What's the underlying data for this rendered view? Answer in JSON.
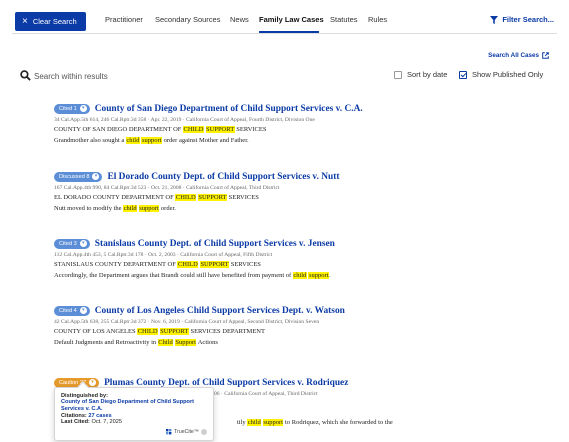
{
  "tabbar": {
    "clear_label": "Clear Search",
    "tabs": [
      "Practitioner",
      "Secondary Sources",
      "News",
      "Family Law Cases",
      "Statutes",
      "Rules"
    ],
    "filter_label": "Filter Search..."
  },
  "search_all_label": "Search All Cases",
  "search": {
    "placeholder": "Search within results",
    "sort_label": "Sort by date",
    "published_label": "Show Published Only"
  },
  "results": [
    {
      "badge": "Cited 1",
      "title": "County of San Diego Department of Child Support Services v. C.A.",
      "cite": "34 Cal.App.5th 614, 246 Cal.Rptr.3d 358  ·  Apr. 22, 2019  ·  California Court of Appeal, Fourth District, Division One",
      "dept_pre": "COUNTY OF SAN DIEGO DEPARTMENT OF ",
      "dept_hl1": "CHILD",
      "dept_mid": " ",
      "dept_hl2": "SUPPORT",
      "dept_post": " SERVICES",
      "snip_pre": "Grandmother also sought a ",
      "snip_hl1": "child",
      "snip_mid": " ",
      "snip_hl2": "support",
      "snip_post": " order against Mother and Father."
    },
    {
      "badge": "Discussed 8",
      "title": "El Dorado County Dept. of Child Support Services v. Nutt",
      "cite": "167 Cal.App.4th 990, 84 Cal.Rptr.3d 523  ·  Oct. 21, 2008  ·  California Court of Appeal, Third District",
      "dept_pre": "EL DORADO COUNTY DEPARTMENT OF ",
      "dept_hl1": "CHILD",
      "dept_mid": " ",
      "dept_hl2": "SUPPORT",
      "dept_post": " SERVICES",
      "snip_pre": "Nutt moved to modify the ",
      "snip_hl1": "child",
      "snip_mid": " ",
      "snip_hl2": "support",
      "snip_post": " order."
    },
    {
      "badge": "Cited 3",
      "title": "Stanislaus County Dept. of Child Support Services v. Jensen",
      "cite": "112 Cal.App.4th 453, 5 Cal.Rptr.3d 178  ·  Oct. 2, 2003  ·  California Court of Appeal, Fifth District",
      "dept_pre": "STANISLAUS COUNTY DEPARTMENT OF ",
      "dept_hl1": "CHILD",
      "dept_mid": " ",
      "dept_hl2": "SUPPORT",
      "dept_post": " SERVICES",
      "snip_pre": "Accordingly, the Department argues that Brandi could still have benefited from payment of ",
      "snip_hl1": "child",
      "snip_mid": " ",
      "snip_hl2": "support",
      "snip_post": "."
    },
    {
      "badge": "Cited 4",
      "title": "County of Los Angeles Child Support Services Dept. v. Watson",
      "cite": "42 Cal.App.5th 638, 255 Cal.Rptr.3d 372  ·  Nov. 6, 2019  ·  California Court of Appeal, Second District, Division Seven",
      "dept_pre": "COUNTY OF LOS ANGELES ",
      "dept_hl1": "CHILD",
      "dept_mid": " ",
      "dept_hl2": "SUPPORT",
      "dept_post": " SERVICES DEPARTMENT",
      "snip_pre": "Default Judgments and Retroactivity in ",
      "snip_hl1": "Child",
      "snip_mid": " ",
      "snip_hl2": "Support",
      "snip_post": " Actions"
    }
  ],
  "last_result": {
    "badge": "Caution 27",
    "title": "Plumas County Dept. of Child Support Services v. Rodriquez",
    "cite_tail": "06  ·  California Court of Appeal, Third District",
    "snip_pre": "tily ",
    "snip_hl1": "child",
    "snip_mid": " ",
    "snip_hl2": "support",
    "snip_post": " to Rodriquez, which she forwarded to the"
  },
  "tooltip": {
    "heading": "Distinguished by:",
    "case_link": "County of San Diego Department of Child Support Services v. C.A.",
    "citations_label": "Citations:",
    "citations_value": "27 cases",
    "last_cited_label": "Last Cited:",
    "last_cited_value": "Oct. 7, 2025",
    "brand": "TrueCite™"
  },
  "colors": {
    "brand_blue": "#0b3ba6",
    "badge_blue": "#5b8ed6",
    "badge_orange": "#e79a2c",
    "highlight": "#fff200"
  }
}
